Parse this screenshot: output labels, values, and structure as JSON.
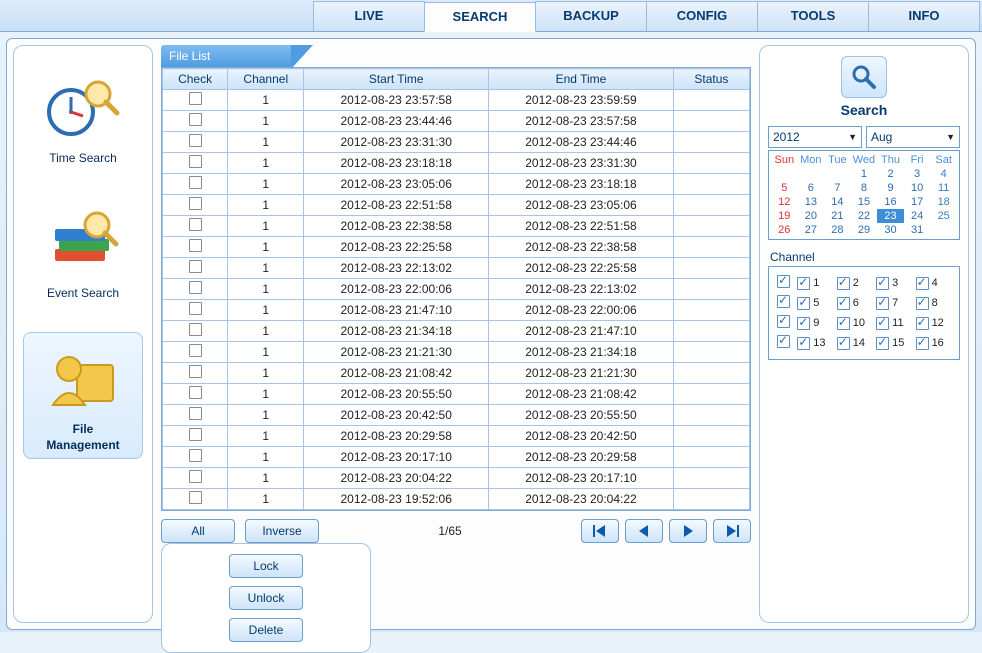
{
  "nav": {
    "tabs": [
      "LIVE",
      "SEARCH",
      "BACKUP",
      "CONFIG",
      "TOOLS",
      "INFO"
    ],
    "active": 1
  },
  "sidebar": {
    "items": [
      {
        "label": "Time Search"
      },
      {
        "label": "Event Search"
      },
      {
        "label": "File Management"
      }
    ],
    "active": 2
  },
  "filelist": {
    "title": "File List",
    "headers": [
      "Check",
      "Channel",
      "Start Time",
      "End Time",
      "Status"
    ],
    "rows": [
      {
        "channel": "1",
        "start": "2012-08-23 23:57:58",
        "end": "2012-08-23 23:59:59",
        "status": ""
      },
      {
        "channel": "1",
        "start": "2012-08-23 23:44:46",
        "end": "2012-08-23 23:57:58",
        "status": ""
      },
      {
        "channel": "1",
        "start": "2012-08-23 23:31:30",
        "end": "2012-08-23 23:44:46",
        "status": ""
      },
      {
        "channel": "1",
        "start": "2012-08-23 23:18:18",
        "end": "2012-08-23 23:31:30",
        "status": ""
      },
      {
        "channel": "1",
        "start": "2012-08-23 23:05:06",
        "end": "2012-08-23 23:18:18",
        "status": ""
      },
      {
        "channel": "1",
        "start": "2012-08-23 22:51:58",
        "end": "2012-08-23 23:05:06",
        "status": ""
      },
      {
        "channel": "1",
        "start": "2012-08-23 22:38:58",
        "end": "2012-08-23 22:51:58",
        "status": ""
      },
      {
        "channel": "1",
        "start": "2012-08-23 22:25:58",
        "end": "2012-08-23 22:38:58",
        "status": ""
      },
      {
        "channel": "1",
        "start": "2012-08-23 22:13:02",
        "end": "2012-08-23 22:25:58",
        "status": ""
      },
      {
        "channel": "1",
        "start": "2012-08-23 22:00:06",
        "end": "2012-08-23 22:13:02",
        "status": ""
      },
      {
        "channel": "1",
        "start": "2012-08-23 21:47:10",
        "end": "2012-08-23 22:00:06",
        "status": ""
      },
      {
        "channel": "1",
        "start": "2012-08-23 21:34:18",
        "end": "2012-08-23 21:47:10",
        "status": ""
      },
      {
        "channel": "1",
        "start": "2012-08-23 21:21:30",
        "end": "2012-08-23 21:34:18",
        "status": ""
      },
      {
        "channel": "1",
        "start": "2012-08-23 21:08:42",
        "end": "2012-08-23 21:21:30",
        "status": ""
      },
      {
        "channel": "1",
        "start": "2012-08-23 20:55:50",
        "end": "2012-08-23 21:08:42",
        "status": ""
      },
      {
        "channel": "1",
        "start": "2012-08-23 20:42:50",
        "end": "2012-08-23 20:55:50",
        "status": ""
      },
      {
        "channel": "1",
        "start": "2012-08-23 20:29:58",
        "end": "2012-08-23 20:42:50",
        "status": ""
      },
      {
        "channel": "1",
        "start": "2012-08-23 20:17:10",
        "end": "2012-08-23 20:29:58",
        "status": ""
      },
      {
        "channel": "1",
        "start": "2012-08-23 20:04:22",
        "end": "2012-08-23 20:17:10",
        "status": ""
      },
      {
        "channel": "1",
        "start": "2012-08-23 19:52:06",
        "end": "2012-08-23 20:04:22",
        "status": ""
      }
    ]
  },
  "buttons": {
    "all": "All",
    "inverse": "Inverse",
    "page": "1/65",
    "lock": "Lock",
    "unlock": "Unlock",
    "delete": "Delete"
  },
  "search": {
    "label": "Search",
    "year": "2012",
    "month": "Aug",
    "dow": [
      "Sun",
      "Mon",
      "Tue",
      "Wed",
      "Thu",
      "Fri",
      "Sat"
    ],
    "weeks": [
      [
        "",
        "",
        "",
        "1",
        "2",
        "3",
        "4"
      ],
      [
        "5",
        "6",
        "7",
        "8",
        "9",
        "10",
        "11"
      ],
      [
        "12",
        "13",
        "14",
        "15",
        "16",
        "17",
        "18"
      ],
      [
        "19",
        "20",
        "21",
        "22",
        "23",
        "24",
        "25"
      ],
      [
        "26",
        "27",
        "28",
        "29",
        "30",
        "31",
        ""
      ]
    ],
    "selected_day": "23"
  },
  "channel": {
    "label": "Channel",
    "list": [
      "1",
      "2",
      "3",
      "4",
      "5",
      "6",
      "7",
      "8",
      "9",
      "10",
      "11",
      "12",
      "13",
      "14",
      "15",
      "16"
    ]
  }
}
